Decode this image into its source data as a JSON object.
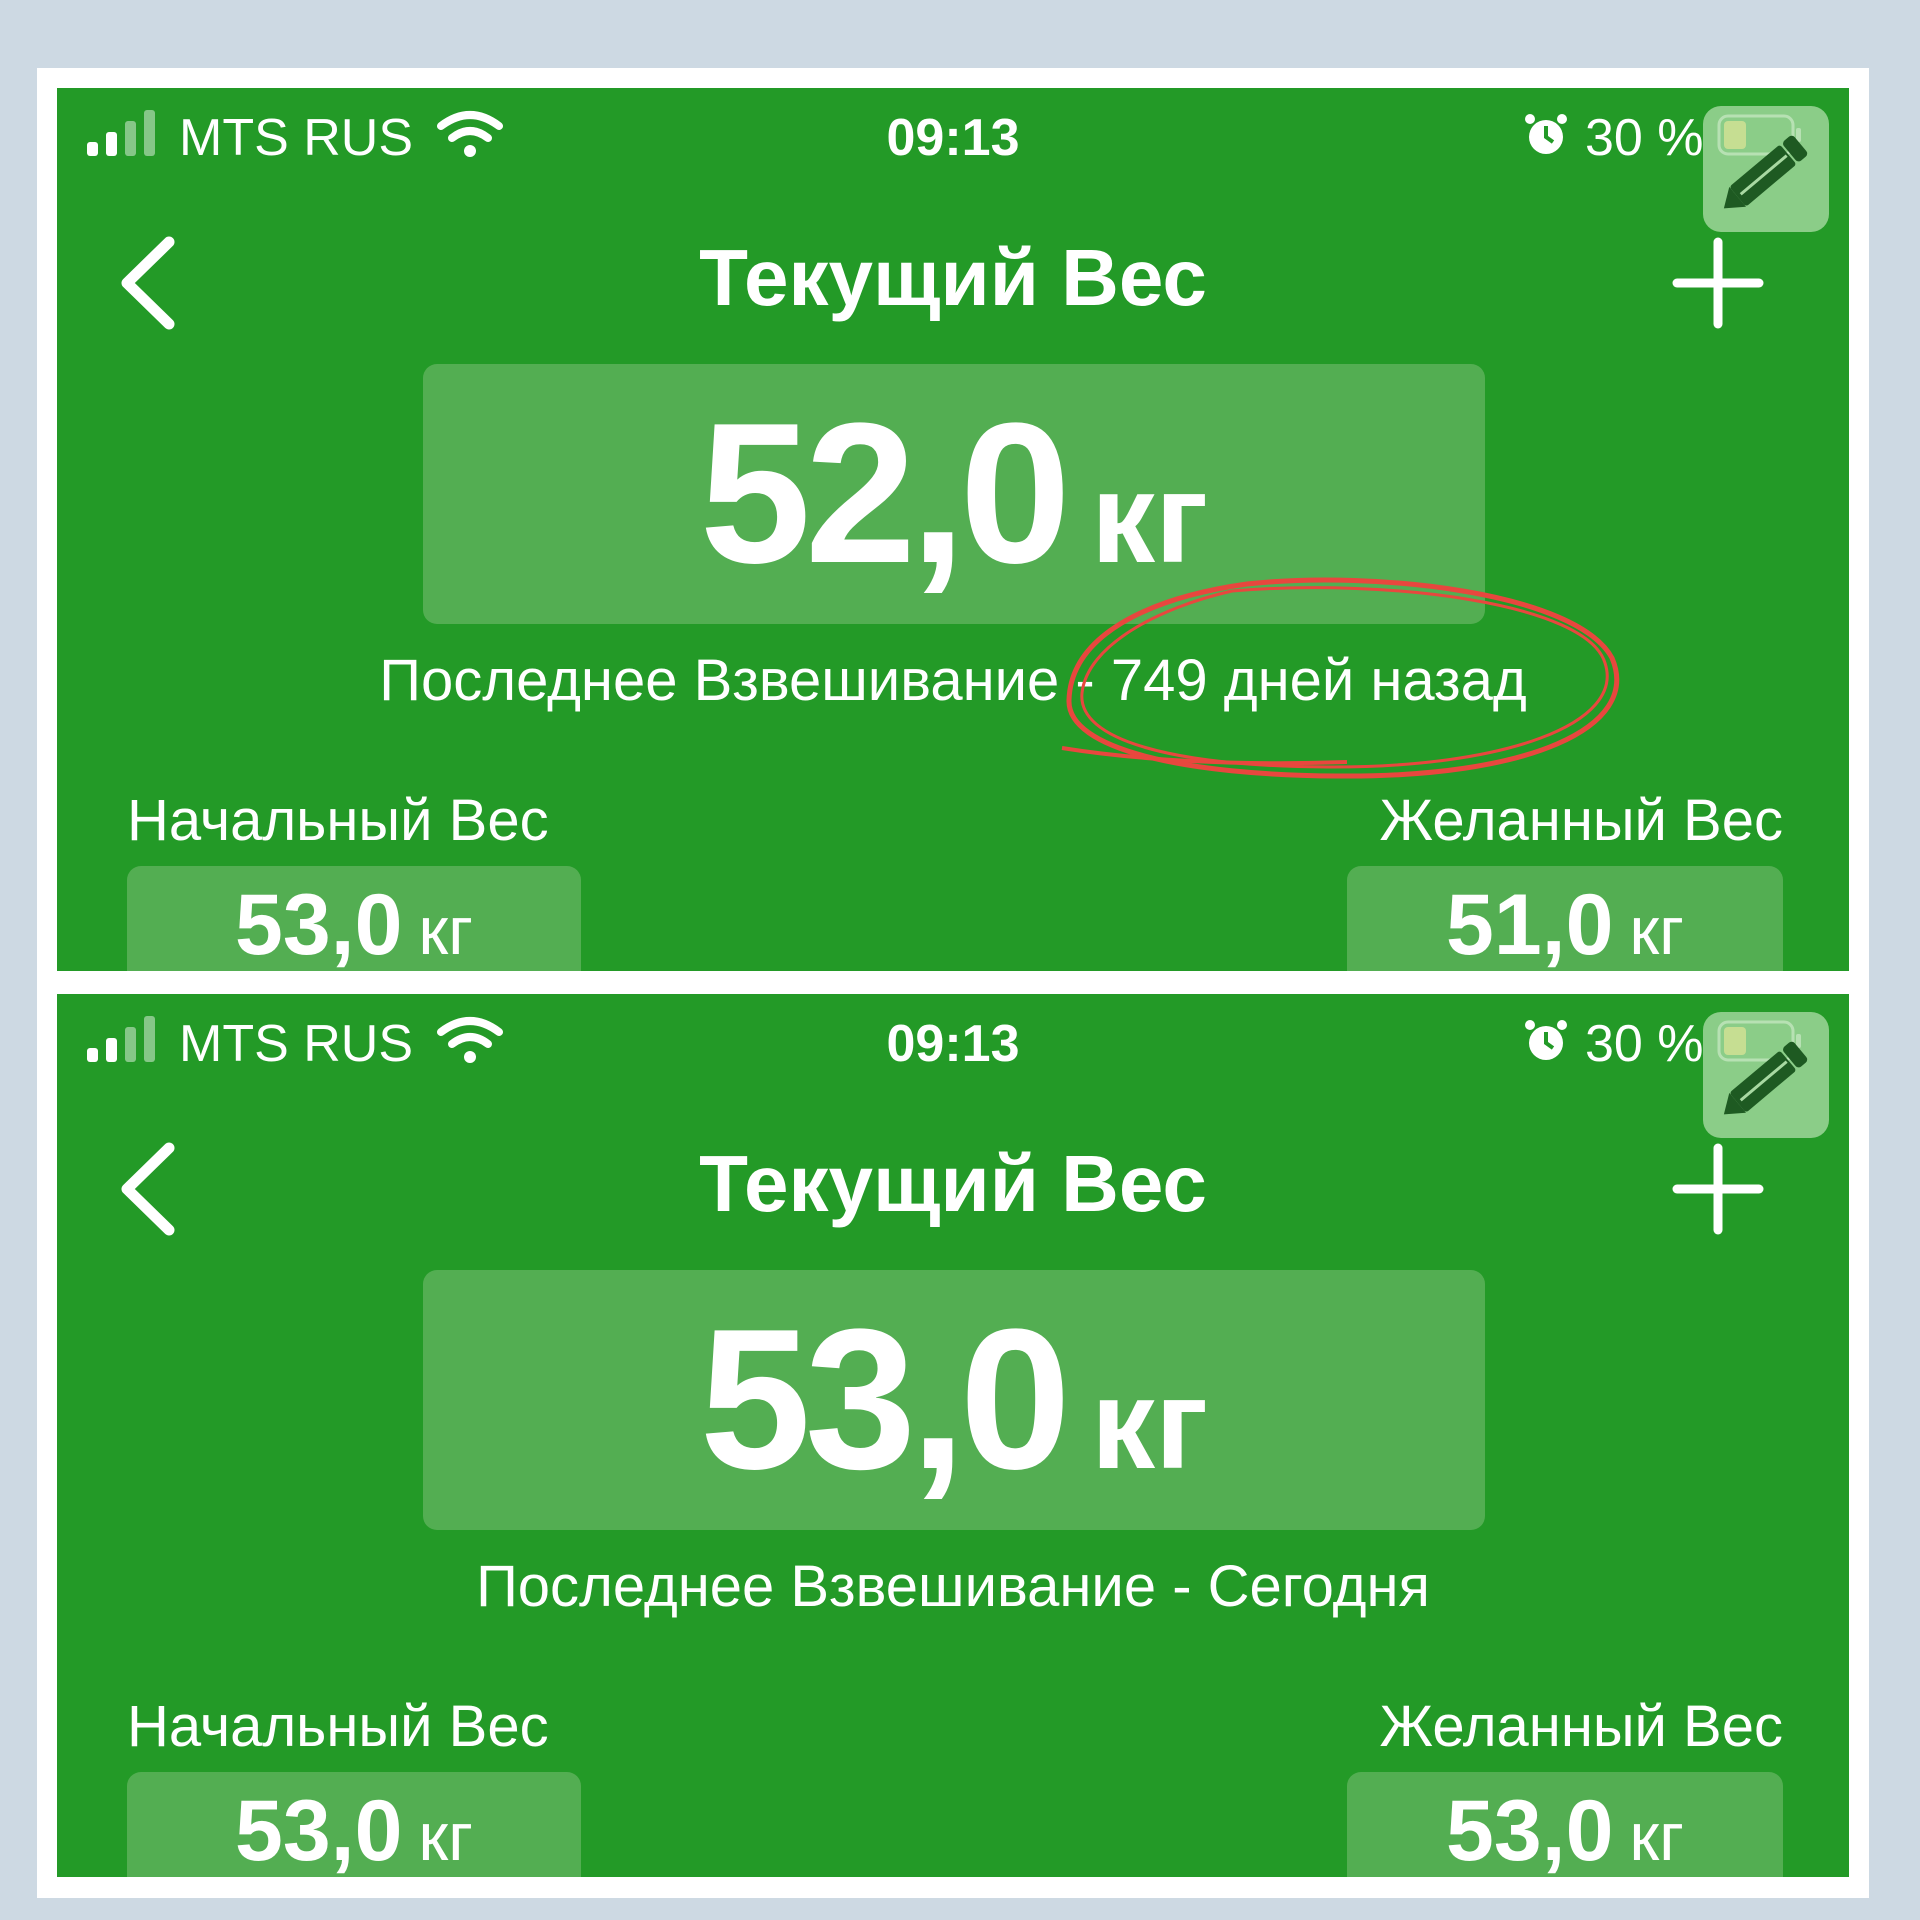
{
  "screens": [
    {
      "status_bar": {
        "carrier": "MTS RUS",
        "time": "09:13",
        "battery_pct": "30 %"
      },
      "nav": {
        "title": "Текущий Вес"
      },
      "current_weight": {
        "value": "52,0",
        "unit": "кг"
      },
      "last_weigh": {
        "text": "Последнее Взвешивание - 749 дней назад"
      },
      "start_weight": {
        "label": "Начальный Вес",
        "value": "53,0",
        "unit": "кг"
      },
      "target_weight": {
        "label": "Желанный Вес",
        "value": "51,0",
        "unit": "кг"
      }
    },
    {
      "status_bar": {
        "carrier": "MTS RUS",
        "time": "09:13",
        "battery_pct": "30 %"
      },
      "nav": {
        "title": "Текущий Вес"
      },
      "current_weight": {
        "value": "53,0",
        "unit": "кг"
      },
      "last_weigh": {
        "text": "Последнее Взвешивание - Сегодня"
      },
      "start_weight": {
        "label": "Начальный Вес",
        "value": "53,0",
        "unit": "кг"
      },
      "target_weight": {
        "label": "Желанный Вес",
        "value": "53,0",
        "unit": "кг"
      }
    }
  ],
  "colors": {
    "background": "#cdd9e3",
    "screen_green": "#239a27",
    "box_green": "#53ae52",
    "annotation_red": "#e8473e",
    "battery_yellow": "#f4d84a"
  },
  "icons": [
    "signal-icon",
    "wifi-icon",
    "alarm-icon",
    "battery-icon",
    "pencil-icon",
    "back-chevron-icon",
    "plus-icon"
  ]
}
